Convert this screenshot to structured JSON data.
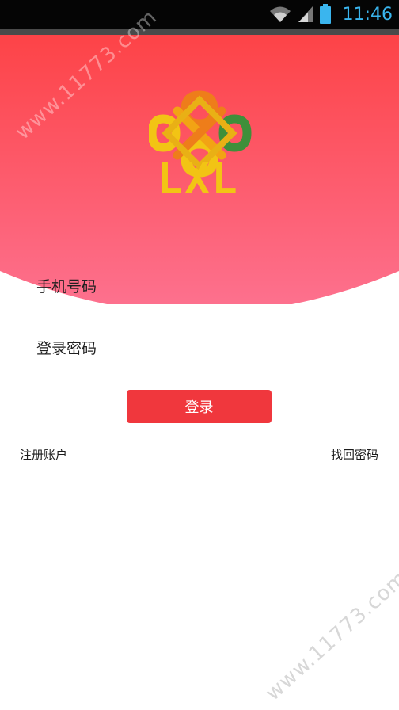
{
  "status_bar": {
    "time": "11:46",
    "icons": [
      "wifi-icon",
      "signal-icon",
      "battery-icon"
    ]
  },
  "brand": {
    "logo_text": "LXL",
    "colors": {
      "gold": "#f2c414",
      "orange": "#ee7d1a",
      "green": "#3f8f3a"
    }
  },
  "form": {
    "phone_placeholder": "手机号码",
    "password_placeholder": "登录密码",
    "login_label": "登录"
  },
  "links": {
    "register": "注册账户",
    "forgot_password": "找回密码"
  },
  "watermark": {
    "text": "www.11773.com"
  },
  "colors": {
    "header_top": "#fd4347",
    "header_bottom": "#fd6e89",
    "primary": "#f0373d",
    "clock": "#3ab5ee"
  }
}
